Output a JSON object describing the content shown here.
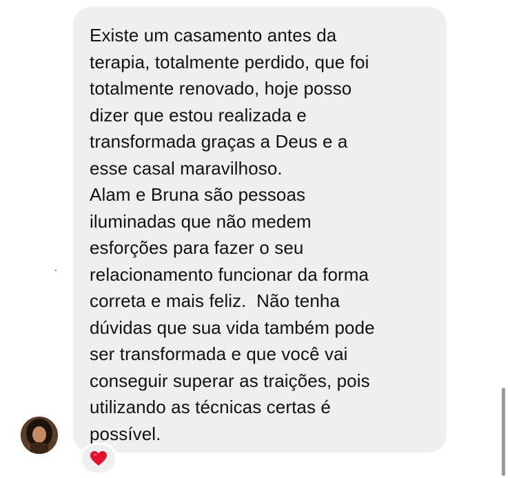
{
  "message": {
    "paragraphs": [
      "Existe um casamento antes da\nterapia, totalmente perdido, que foi\ntotalmente renovado, hoje posso\ndizer que estou realizada e\ntransformada graças a Deus e a\nesse casal maravilhoso.",
      "Alam e Bruna são pessoas\niluminadas que não medem\nesforções para fazer o seu\nrelacionamento funcionar da forma\ncorreta e mais feliz.  Não tenha\ndúvidas que sua vida também pode\nser transformada e que você vai\nconseguir superar as traições, pois\nutilizando as técnicas certas é\npossível."
    ],
    "reaction_icon": "red-heart-icon",
    "bubble_color": "#efefef",
    "reaction_color": "#e0112b"
  },
  "sender": {
    "avatar_icon": "profile-photo"
  }
}
